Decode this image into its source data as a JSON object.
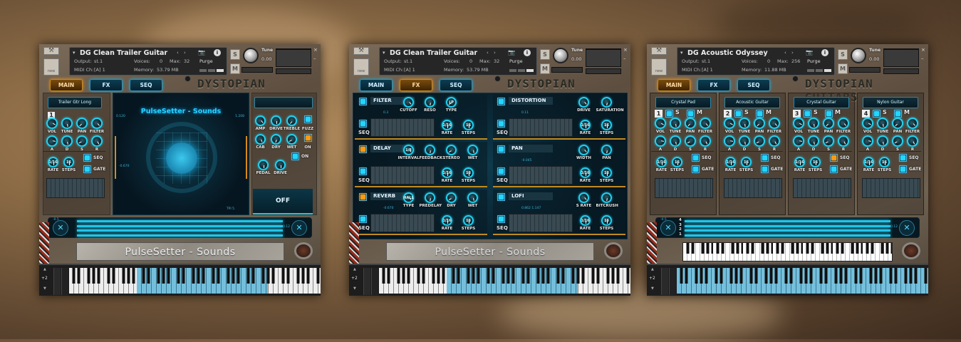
{
  "panels": [
    {
      "type": "main",
      "header": {
        "instrument": "DG Clean Trailer Guitar",
        "output_label": "Output:",
        "output": "st.1",
        "midi_label": "MIDI Ch:",
        "midi": "[A] 1",
        "voices_label": "Voices:",
        "voices": "0",
        "max_label": "Max:",
        "max": "32",
        "memory_label": "Memory:",
        "memory": "53.79 MB",
        "purge": "Purge",
        "tune_label": "Tune",
        "tune": "0.00",
        "new_label": "new",
        "s": "S",
        "m": "M"
      },
      "tabs": [
        {
          "label": "MAIN",
          "active": true
        },
        {
          "label": "FX",
          "active": false
        },
        {
          "label": "SEQ",
          "active": false
        }
      ],
      "logo": "DYSTOPIAN GUITARS",
      "preset": "Trailer Gtr Long",
      "layer_number": "1",
      "knobs_row1": [
        "VOL",
        "TUNE",
        "PAN",
        "FILTER"
      ],
      "knobs_row2": [
        "A",
        "D",
        "S",
        "R"
      ],
      "rate": {
        "label": "RATE",
        "value": "1/16"
      },
      "steps": {
        "label": "STEPS",
        "value": "16"
      },
      "seq_label": "SEQ",
      "gate_label": "GATE",
      "display_title": "PulseSetter - Sounds",
      "display_readouts": [
        "0.120",
        "-0.670",
        "1.208",
        "TPI 5"
      ],
      "amp_knobs_row1": [
        "AMP",
        "DRIVE",
        "TREBLE"
      ],
      "fuzz_label": "FUZZ",
      "amp_knobs_row2": [
        "CAB",
        "DRY",
        "WET"
      ],
      "amp_on_label": "ON",
      "pedal_on_label": "ON",
      "pedal_knobs": [
        "PEDAL",
        "DRIVE"
      ],
      "off_button": "OFF",
      "bar_readouts": [
        "-0.5",
        "0.12"
      ],
      "nameplate": "PulseSetter - Sounds",
      "octave": "+2"
    },
    {
      "type": "fx",
      "header": {
        "instrument": "DG Clean Trailer Guitar",
        "output_label": "Output:",
        "output": "st.1",
        "midi_label": "MIDI Ch:",
        "midi": "[A] 1",
        "voices_label": "Voices:",
        "voices": "0",
        "max_label": "Max:",
        "max": "32",
        "memory_label": "Memory:",
        "memory": "53.79 MB",
        "purge": "Purge",
        "tune_label": "Tune",
        "tune": "0.00",
        "new_label": "new",
        "s": "S",
        "m": "M"
      },
      "tabs": [
        {
          "label": "MAIN",
          "active": false
        },
        {
          "label": "FX",
          "active": true
        },
        {
          "label": "SEQ",
          "active": false
        }
      ],
      "logo": "DYSTOPIAN GUITARS",
      "modules": [
        {
          "name": "FILTER",
          "state": "cyan",
          "knobs": [
            {
              "label": "CUTOFF"
            },
            {
              "label": "RESO"
            },
            {
              "label": "TYPE",
              "value": "LP"
            }
          ],
          "readout": "0.3"
        },
        {
          "name": "DISTORTION",
          "state": "cyan",
          "knobs": [
            {
              "label": "DRIVE"
            },
            {
              "label": "SATURATION"
            }
          ],
          "readout": "0.11"
        },
        {
          "name": "DELAY",
          "state": "orange",
          "knobs": [
            {
              "label": "INTERVAL",
              "value": "1/8"
            },
            {
              "label": "FEEDBACK"
            },
            {
              "label": "STEREO"
            },
            {
              "label": "WET"
            }
          ],
          "readout": ""
        },
        {
          "name": "PAN",
          "state": "cyan",
          "knobs": [
            {
              "label": "WIDTH"
            },
            {
              "label": "PAN"
            }
          ],
          "readout": "-0.045"
        },
        {
          "name": "REVERB",
          "state": "orange",
          "knobs": [
            {
              "label": "TYPE",
              "value": "HALL"
            },
            {
              "label": "PREDELAY"
            },
            {
              "label": "DRY"
            },
            {
              "label": "WET"
            }
          ],
          "readout": "-0.670"
        },
        {
          "name": "LOFI",
          "state": "cyan",
          "knobs": [
            {
              "label": "S RATE"
            },
            {
              "label": "BITCRUSH"
            }
          ],
          "readout": "0.862   1.147"
        }
      ],
      "seq_label": "SEQ",
      "rate": {
        "label": "RATE",
        "value": "1/16"
      },
      "steps": {
        "label": "STEPS",
        "value": "16"
      },
      "nameplate": "PulseSetter - Sounds",
      "octave": "+2"
    },
    {
      "type": "layers",
      "header": {
        "instrument": "DG Acoustic Odyssey",
        "output_label": "Output:",
        "output": "st.1",
        "midi_label": "MIDI Ch:",
        "midi": "[A] 1",
        "voices_label": "Voices:",
        "voices": "0",
        "max_label": "Max:",
        "max": "256",
        "memory_label": "Memory:",
        "memory": "11.88 MB",
        "purge": "Purge",
        "tune_label": "Tune",
        "tune": "0.00",
        "new_label": "new",
        "s": "S",
        "m": "M"
      },
      "tabs": [
        {
          "label": "MAIN",
          "active": true
        },
        {
          "label": "FX",
          "active": false
        },
        {
          "label": "SEQ",
          "active": false
        }
      ],
      "logo": "DYSTOPIAN GUITARS",
      "layers": [
        {
          "number": "1",
          "name": "Crystal Pad",
          "seq_state": "cyan"
        },
        {
          "number": "2",
          "name": "Acoustic Guitar",
          "seq_state": "cyan"
        },
        {
          "number": "3",
          "name": "Crystal Guitar",
          "seq_state": "orange"
        },
        {
          "number": "4",
          "name": "Nylon Guitar",
          "seq_state": "cyan"
        }
      ],
      "solo_label": "S",
      "mute_label": "M",
      "knobs_row1": [
        "VOL",
        "TUNE",
        "PAN",
        "FILTER"
      ],
      "knobs_row2": [
        "A",
        "D",
        "S",
        "R"
      ],
      "rate": {
        "label": "RATE",
        "value": "1/16"
      },
      "steps": {
        "label": "STEPS",
        "value": "16"
      },
      "seq_label": "SEQ",
      "gate_label": "GATE",
      "bar_labels": [
        "4",
        "3",
        "2",
        "1"
      ],
      "bar_readouts": [
        "-0.5",
        "0.12"
      ],
      "octave": "+2"
    }
  ],
  "colors": {
    "accent": "#22d6ff",
    "active_tab": "#c98a20",
    "orange": "#ff9a10"
  }
}
